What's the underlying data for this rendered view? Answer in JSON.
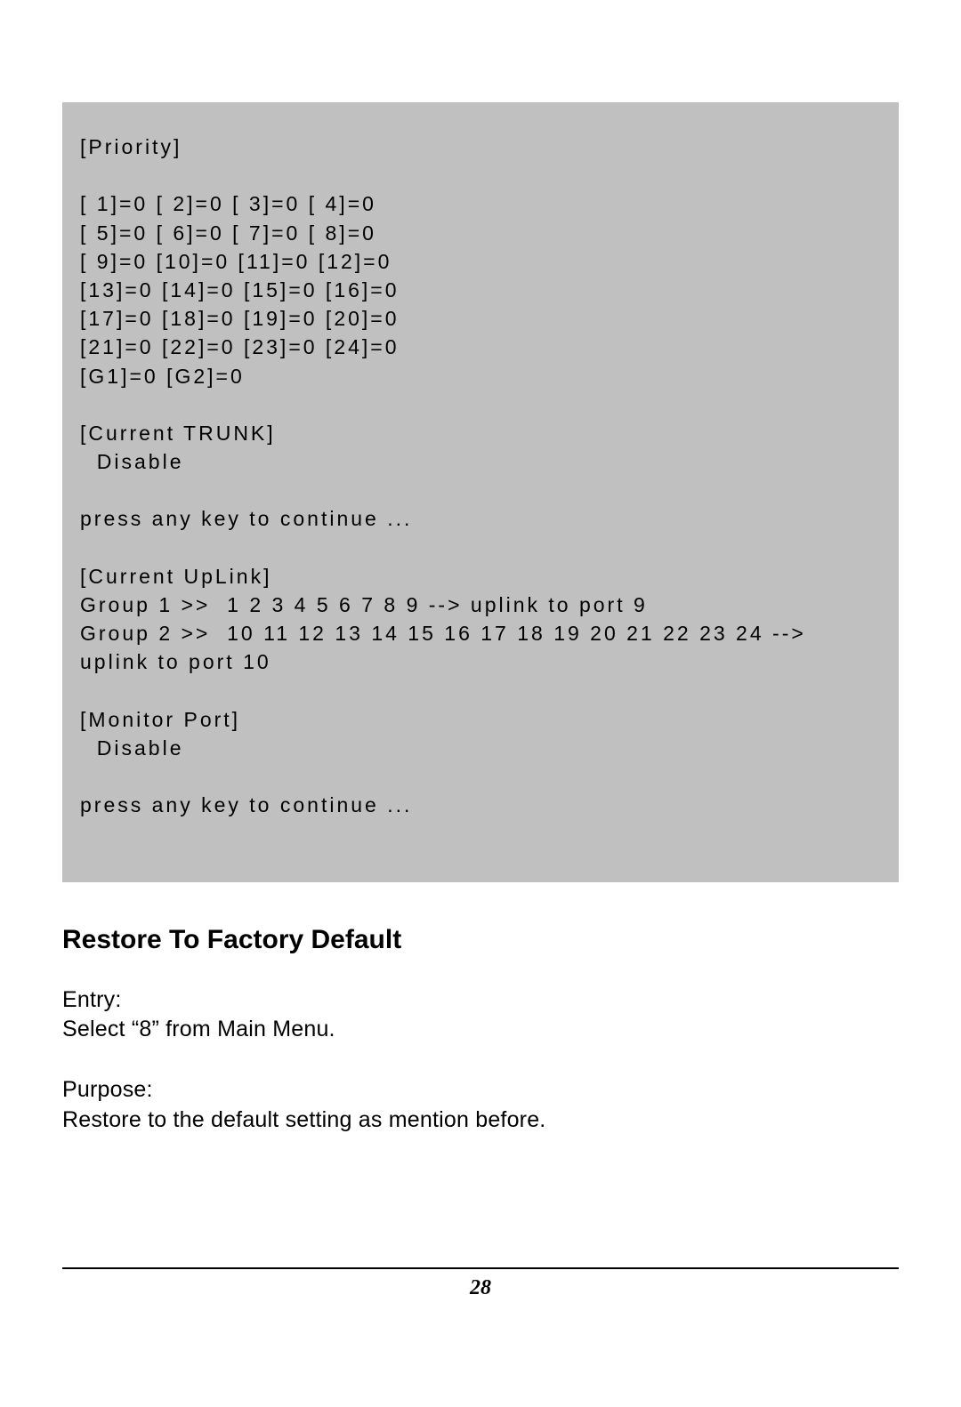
{
  "console": {
    "lines": [
      "[Priority]",
      "",
      "[ 1]=0 [ 2]=0 [ 3]=0 [ 4]=0",
      "[ 5]=0 [ 6]=0 [ 7]=0 [ 8]=0",
      "[ 9]=0 [10]=0 [11]=0 [12]=0",
      "[13]=0 [14]=0 [15]=0 [16]=0",
      "[17]=0 [18]=0 [19]=0 [20]=0",
      "[21]=0 [22]=0 [23]=0 [24]=0",
      "[G1]=0 [G2]=0",
      "",
      "[Current TRUNK]",
      "  Disable",
      "",
      "press any key to continue ...",
      "",
      "[Current UpLink]",
      "Group 1 >>  1 2 3 4 5 6 7 8 9 --> uplink to port 9",
      "Group 2 >>  10 11 12 13 14 15 16 17 18 19 20 21 22 23 24 -->",
      "uplink to port 10",
      "",
      "[Monitor Port]",
      "  Disable",
      "",
      "press any key to continue ..."
    ]
  },
  "section": {
    "heading": "Restore To Factory Default",
    "entry_label": "Entry:",
    "entry_text": "Select “8” from Main Menu.",
    "purpose_label": "Purpose:",
    "purpose_text": "Restore to the default setting as mention before."
  },
  "page_number": "28"
}
